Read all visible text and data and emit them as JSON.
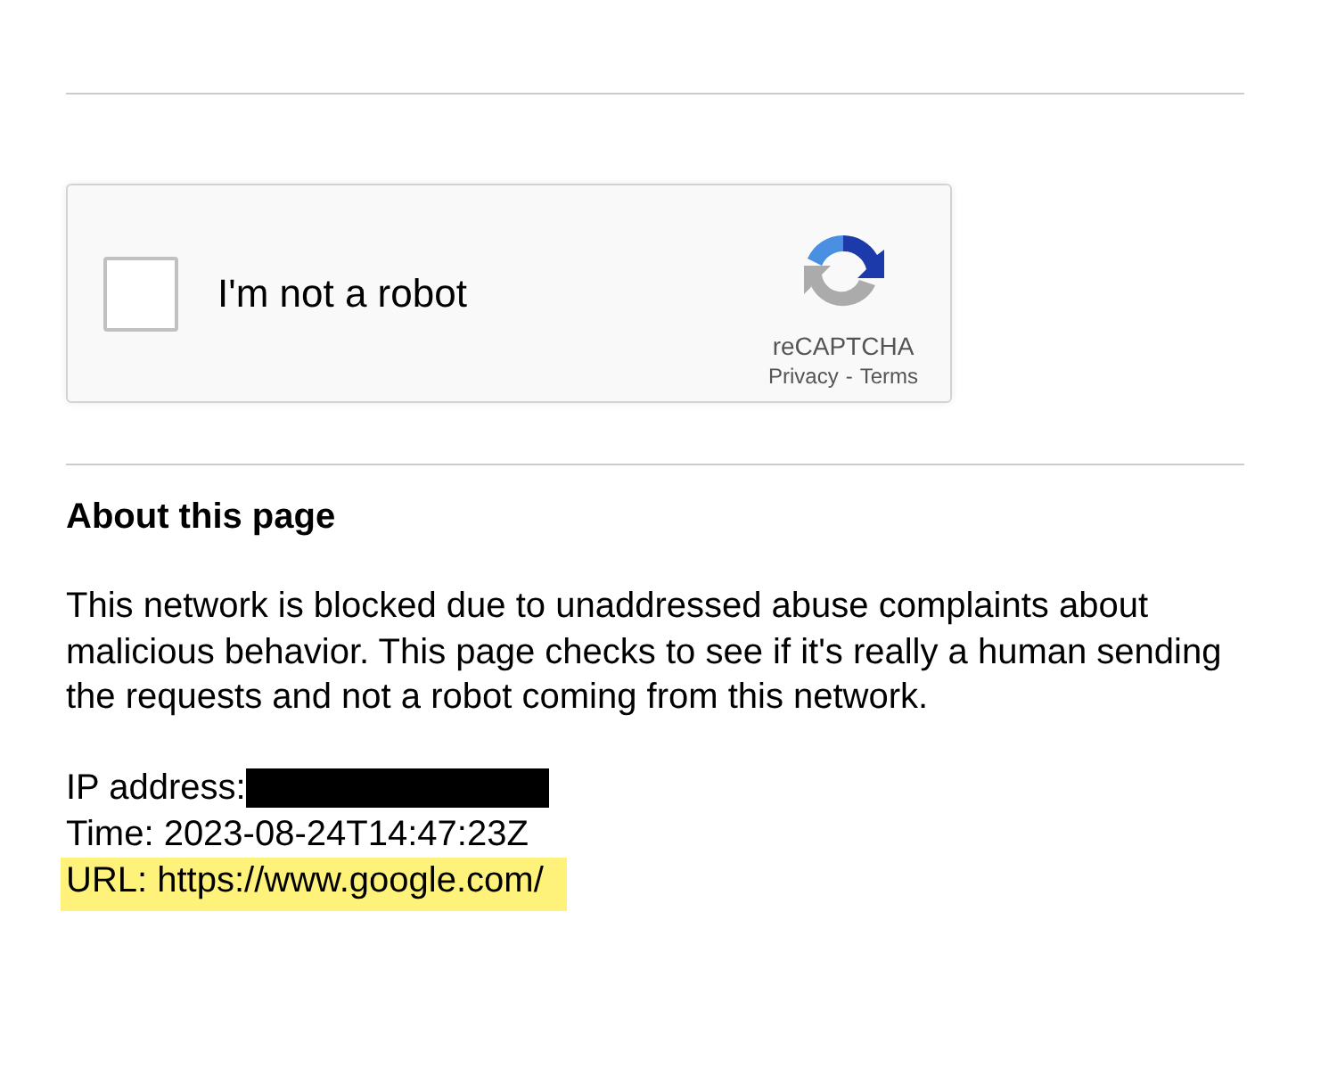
{
  "captcha": {
    "checked": false,
    "label": "I'm not a robot",
    "brand": "reCAPTCHA",
    "privacy": "Privacy",
    "separator": "-",
    "terms": "Terms"
  },
  "about": {
    "heading": "About this page",
    "paragraph": "This network is blocked due to unaddressed abuse complaints about malicious behavior. This page checks to see if it's really a human sending the requests and not a robot coming from this network.",
    "details": [
      {
        "kind": "redacted",
        "text": "IP address:",
        "highlighted": false
      },
      {
        "kind": "plain",
        "text": "Time: 2023-08-24T14:47:23Z",
        "highlighted": false
      },
      {
        "kind": "plain",
        "text": "URL: https://www.google.com/",
        "highlighted": true
      }
    ]
  }
}
